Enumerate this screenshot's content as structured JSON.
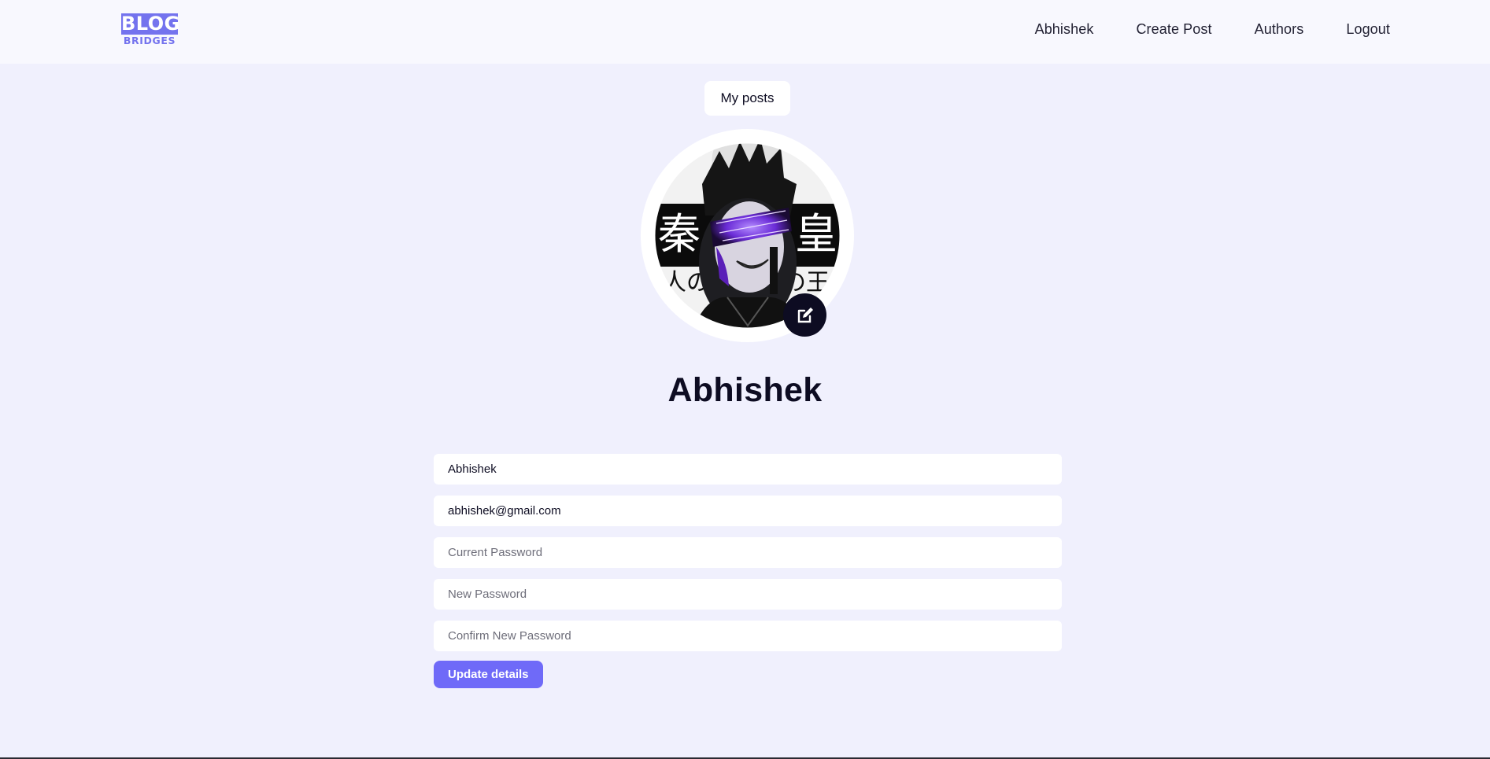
{
  "nav": {
    "logo_top": "BLOG",
    "logo_bottom": "BRIDGES",
    "links": [
      {
        "label": "Abhishek"
      },
      {
        "label": "Create Post"
      },
      {
        "label": "Authors"
      },
      {
        "label": "Logout"
      }
    ]
  },
  "profile": {
    "my_posts_label": "My posts",
    "name": "Abhishek",
    "avatar_icon": "user-avatar-image",
    "edit_icon": "edit-icon"
  },
  "form": {
    "name_value": "Abhishek",
    "email_value": "abhishek@gmail.com",
    "current_password_placeholder": "Current Password",
    "new_password_placeholder": "New Password",
    "confirm_password_placeholder": "Confirm New Password",
    "submit_label": "Update details"
  },
  "colors": {
    "background": "#f0f0fd",
    "navbar": "#f8f8fe",
    "accent": "#6f6af8",
    "dark": "#0d0c22"
  }
}
